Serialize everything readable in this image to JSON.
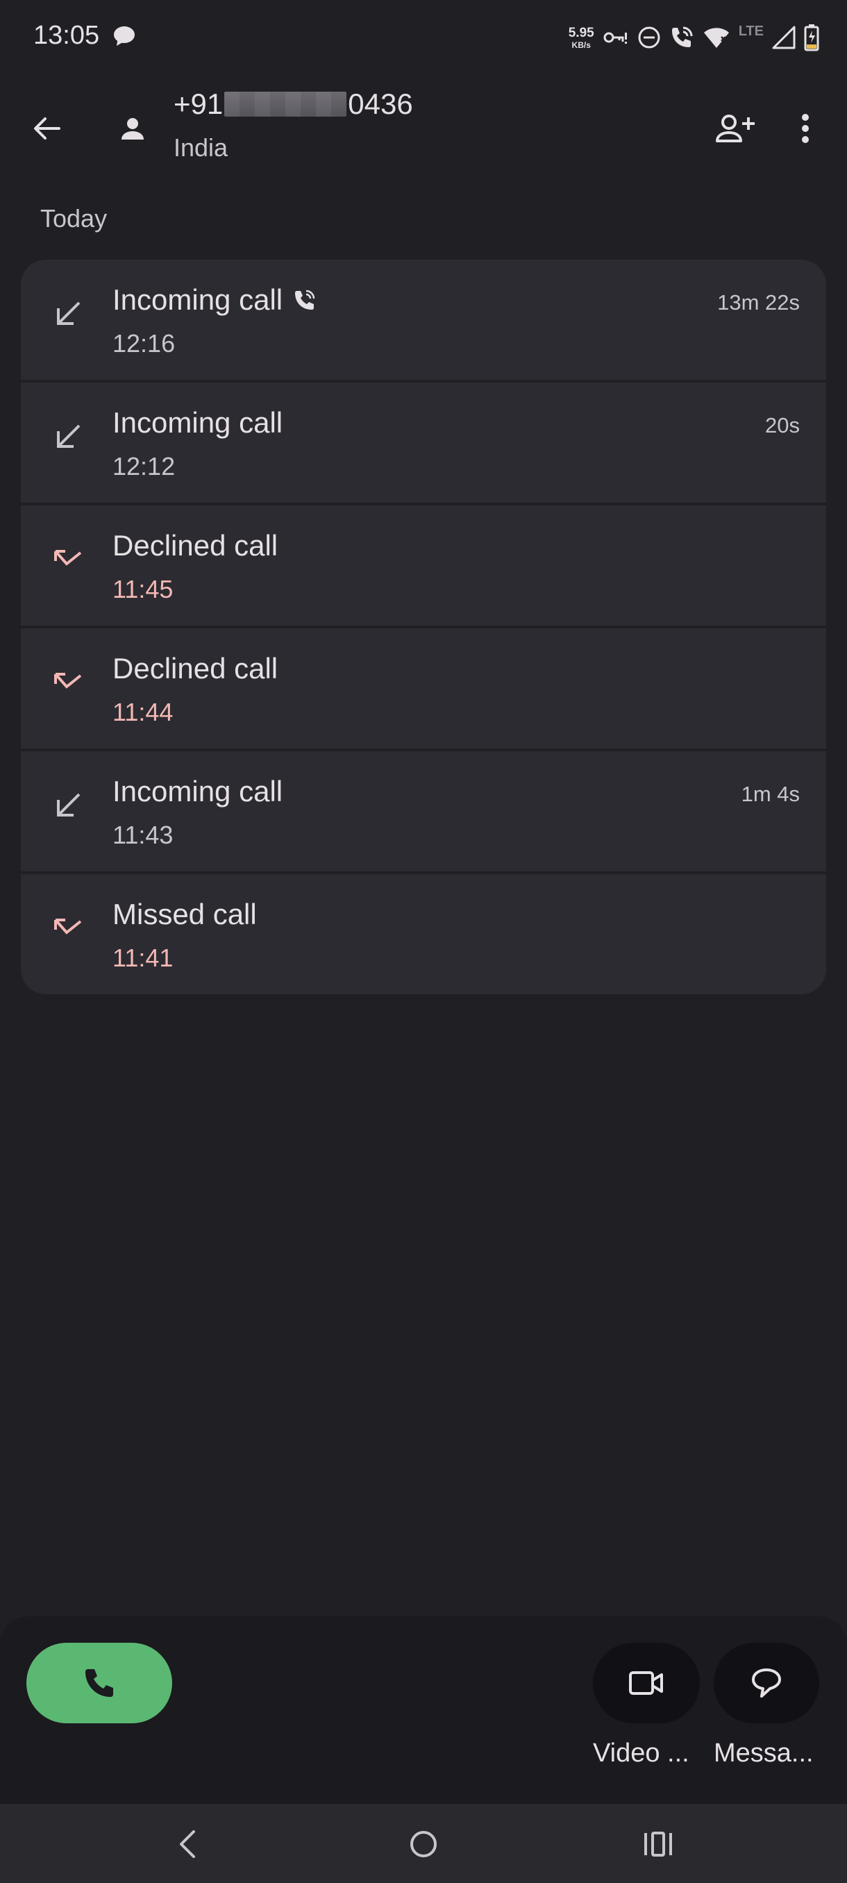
{
  "status_bar": {
    "time": "13:05",
    "net_speed_value": "5.95",
    "net_speed_unit": "KB/s",
    "network_type": "LTE",
    "icons": [
      "chat-bubble-icon",
      "vpn-key-icon",
      "dnd-icon",
      "wifi-calling-icon",
      "wifi-icon",
      "signal-icon",
      "battery-charging-icon"
    ]
  },
  "header": {
    "number_prefix": "+91",
    "number_suffix": "0436",
    "country": "India"
  },
  "section": {
    "label": "Today"
  },
  "calls": [
    {
      "type": "Incoming call",
      "time": "12:16",
      "duration": "13m 22s",
      "direction": "incoming",
      "wifi_call": true
    },
    {
      "type": "Incoming call",
      "time": "12:12",
      "duration": "20s",
      "direction": "incoming",
      "wifi_call": false
    },
    {
      "type": "Declined call",
      "time": "11:45",
      "duration": "",
      "direction": "declined",
      "wifi_call": false
    },
    {
      "type": "Declined call",
      "time": "11:44",
      "duration": "",
      "direction": "declined",
      "wifi_call": false
    },
    {
      "type": "Incoming call",
      "time": "11:43",
      "duration": "1m 4s",
      "direction": "incoming",
      "wifi_call": false
    },
    {
      "type": "Missed call",
      "time": "11:41",
      "duration": "",
      "direction": "missed",
      "wifi_call": false
    }
  ],
  "actions": {
    "video_label": "Video ...",
    "message_label": "Messa..."
  },
  "colors": {
    "background": "#201f24",
    "row_background": "#2c2b31",
    "call_button": "#5bb872",
    "missed_accent": "#f2b8b5"
  }
}
